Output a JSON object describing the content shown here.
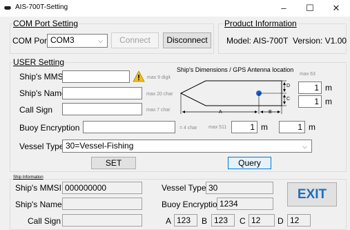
{
  "window": {
    "title": "AIS-700T-Setting",
    "minimize": "–",
    "maximize": "☐",
    "close": "✕"
  },
  "com": {
    "section_title": "COM Port Setting",
    "port_label": "COM Port",
    "port_value": "COM3",
    "connect_label": "Connect",
    "disconnect_label": "Disconnect"
  },
  "product": {
    "section_title": "Product Information",
    "model_text": "Model: AIS-700T",
    "version_text": "Version:  V1.00"
  },
  "user": {
    "section_title": "USER Setting",
    "mmsi_label": "Ship's MMSI",
    "mmsi_hint": "max 9 digit",
    "name_label": "Ship's Name",
    "name_hint": "max 20 char",
    "callsign_label": "Call Sign",
    "callsign_hint": "max 7 char",
    "buoy_label": "Buoy Encryption",
    "buoy_hint": "= 4 char",
    "vessel_label": "Vessel Type",
    "vessel_value": "30=Vessel-Fishing",
    "set_label": "SET",
    "query_label": "Query"
  },
  "dimensions": {
    "title": "Ship's Dimensions / GPS Antenna location",
    "max63": "max 63",
    "max511": "max 511",
    "A": "1",
    "B": "1",
    "C": "1",
    "D": "1",
    "unit": "m",
    "letter_A": "A",
    "letter_B": "B",
    "letter_C": "C",
    "letter_D": "D"
  },
  "info": {
    "section_title": "Ship Information",
    "mmsi_label": "Ship's MMSI",
    "mmsi_value": "000000000",
    "name_label": "Ship's Name",
    "name_value": "",
    "callsign_label": "Call Sign",
    "callsign_value": "",
    "vessel_label": "Vessel Type",
    "vessel_value": "30",
    "buoy_label": "Buoy Encryption",
    "buoy_value": "1234",
    "a_label": "A",
    "a_value": "123",
    "b_label": "B",
    "b_value": "123",
    "c_label": "C",
    "c_value": "12",
    "d_label": "D",
    "d_value": "12",
    "exit_label": "EXIT"
  },
  "colors": {
    "accent": "#0078d7",
    "exit_text": "#1a6fc0",
    "warning": "#f0c020",
    "gps_dot": "#1e5fc8"
  }
}
